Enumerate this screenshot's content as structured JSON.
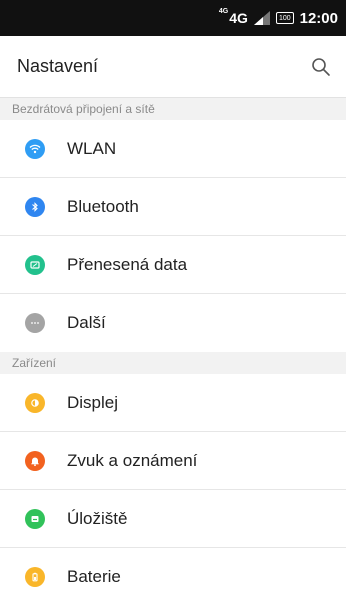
{
  "status_bar": {
    "network_sup": "4G",
    "network_main": "4G",
    "battery_text": "100",
    "time": "12:00"
  },
  "app_bar": {
    "title": "Nastavení",
    "search_icon": "search-icon"
  },
  "sections": [
    {
      "header": "Bezdrátová připojení a sítě",
      "items": [
        {
          "label": "WLAN",
          "icon": "wifi-icon",
          "color": "#2f9df4"
        },
        {
          "label": "Bluetooth",
          "icon": "bluetooth-icon",
          "color": "#2f86f0"
        },
        {
          "label": "Přenesená data",
          "icon": "data-usage-icon",
          "color": "#22c18d"
        },
        {
          "label": "Další",
          "icon": "more-icon",
          "color": "#a4a4a4"
        }
      ]
    },
    {
      "header": "Zařízení",
      "items": [
        {
          "label": "Displej",
          "icon": "display-icon",
          "color": "#f9b62a"
        },
        {
          "label": "Zvuk a oznámení",
          "icon": "bell-icon",
          "color": "#f2621f"
        },
        {
          "label": "Úložiště",
          "icon": "storage-icon",
          "color": "#31c25a"
        },
        {
          "label": "Baterie",
          "icon": "battery-icon",
          "color": "#f9b62a"
        }
      ]
    }
  ]
}
